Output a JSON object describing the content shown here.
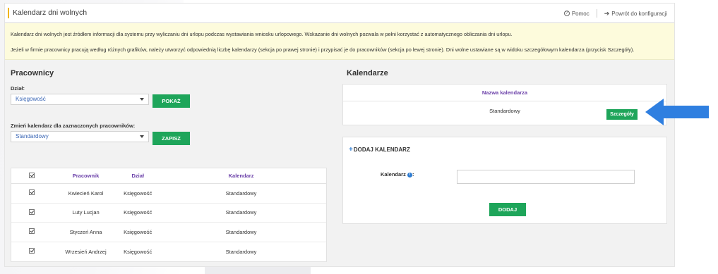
{
  "header": {
    "title": "Kalendarz dni wolnych",
    "help_label": "Pomoc",
    "back_label": "Powrót do konfiguracji"
  },
  "notice": {
    "line1": "Kalendarz dni wolnych jest źródłem informacji dla systemu przy wyliczaniu dni urlopu podczas wystawiania wniosku urlopowego. Wskazanie dni wolnych pozwala w pełni korzystać z automatycznego obliczania dni urlopu.",
    "line2": "Jeżeli w firmie pracownicy pracują według różnych grafików, należy utworzyć odpowiednią liczbę kalendarzy (sekcja po prawej stronie) i przypisać je do pracowników (sekcja po lewej stronie). Dni wolne ustawiane są w widoku szczegółowym kalendarza (przycisk Szczegóły)."
  },
  "employees": {
    "section_title": "Pracownicy",
    "department_label": "Dział:",
    "department_value": "Księgowość",
    "show_button": "POKAŻ",
    "change_label": "Zmień kalendarz dla zaznaczonych pracowników:",
    "calendar_value": "Standardowy",
    "save_button": "ZAPISZ",
    "table": {
      "headers": {
        "employee": "Pracownik",
        "department": "Dział",
        "calendar": "Kalendarz"
      },
      "rows": [
        {
          "name": "Kwiecień Karol",
          "department": "Księgowość",
          "calendar": "Standardowy"
        },
        {
          "name": "Luty Lucjan",
          "department": "Księgowość",
          "calendar": "Standardowy"
        },
        {
          "name": "Styczeń Anna",
          "department": "Księgowość",
          "calendar": "Standardowy"
        },
        {
          "name": "Wrzesień Andrzej",
          "department": "Księgowość",
          "calendar": "Standardowy"
        }
      ]
    }
  },
  "calendars": {
    "section_title": "Kalendarze",
    "name_header": "Nazwa kalendarza",
    "items": [
      {
        "name": "Standardowy",
        "details_button": "Szczegóły"
      }
    ],
    "add": {
      "title": "DODAJ KALENDARZ",
      "field_label": "Kalendarz",
      "input_value": "",
      "add_button": "DODAJ"
    }
  },
  "colors": {
    "accent_green": "#1ea55a",
    "header_purple": "#6a3fa8",
    "notice_bg": "#fdfbdc",
    "arrow_blue": "#2f7fe0"
  }
}
